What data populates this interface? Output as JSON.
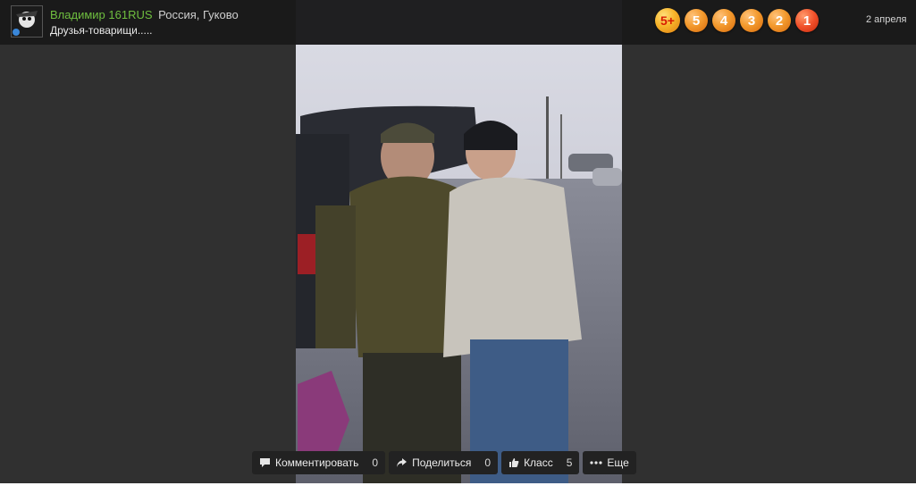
{
  "header": {
    "author_name": "Владимир 161RUS",
    "author_location": "Россия, Гуково",
    "caption": "Друзья-товарищи.....",
    "date": "2 апреля"
  },
  "rating": {
    "buttons": [
      "5+",
      "5",
      "4",
      "3",
      "2",
      "1"
    ]
  },
  "actions": {
    "comment_label": "Комментировать",
    "comment_count": "0",
    "share_label": "Поделиться",
    "share_count": "0",
    "like_label": "Класс",
    "like_count": "5",
    "more_label": "Еще"
  },
  "colors": {
    "author_link": "#6fbf3f",
    "rating_orange": "#f39a2e",
    "rating_red": "#e0401a"
  }
}
